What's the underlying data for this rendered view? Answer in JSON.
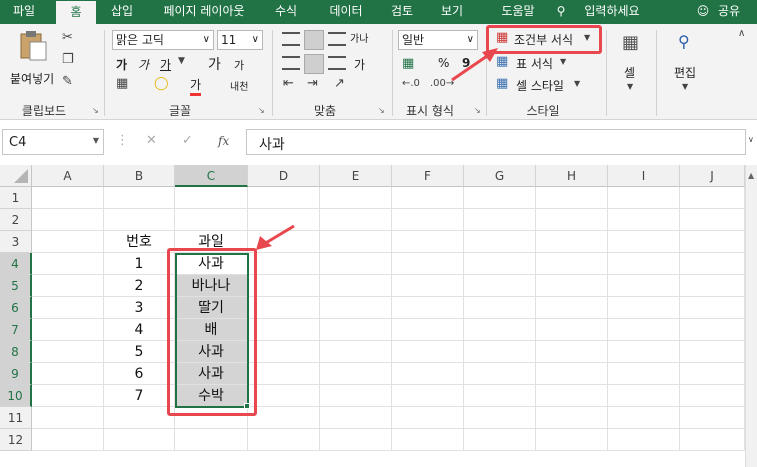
{
  "tabs": [
    "파일",
    "홈",
    "삽입",
    "페이지 레이아웃",
    "수식",
    "데이터",
    "검토",
    "보기",
    "도움말",
    "입력하세요"
  ],
  "share_label": "공유",
  "ribbon": {
    "clipboard": {
      "paste_label": "붙여넣기",
      "group_label": "클립보드"
    },
    "font": {
      "font_name": "맑은 고딕",
      "font_size": "11",
      "bold": "가",
      "italic": "가",
      "underline": "가",
      "grow": "가",
      "shrink": "가",
      "font_color": "가",
      "phonetic": "내천",
      "group_label": "글꼴"
    },
    "align": {
      "wrap": "가나",
      "merge": "가",
      "group_label": "맞춤"
    },
    "number": {
      "format": "일반",
      "percent": "%",
      "comma": "9",
      "group_label": "표시 형식"
    },
    "styles": {
      "conditional": "조건부 서식",
      "table": "표 서식",
      "cell_style": "셀 스타일",
      "group_label": "스타일"
    },
    "cells": {
      "label": "셀"
    },
    "editing": {
      "label": "편집"
    }
  },
  "formula_bar": {
    "name_box": "C4",
    "fx": "fx",
    "content": "사과"
  },
  "columns": [
    "A",
    "B",
    "C",
    "D",
    "E",
    "F",
    "G",
    "H",
    "I",
    "J"
  ],
  "rows": [
    "1",
    "2",
    "3",
    "4",
    "5",
    "6",
    "7",
    "8",
    "9",
    "10",
    "11",
    "12"
  ],
  "sheet": {
    "header_b": "번호",
    "header_c": "과일",
    "numbers": [
      "1",
      "2",
      "3",
      "4",
      "5",
      "6",
      "7"
    ],
    "fruits": [
      "사과",
      "바나나",
      "딸기",
      "배",
      "사과",
      "사과",
      "수박"
    ]
  },
  "colors": {
    "excel_green": "#217346",
    "highlight_red": "#e8474e",
    "selection_gray": "#d4d4d4"
  }
}
